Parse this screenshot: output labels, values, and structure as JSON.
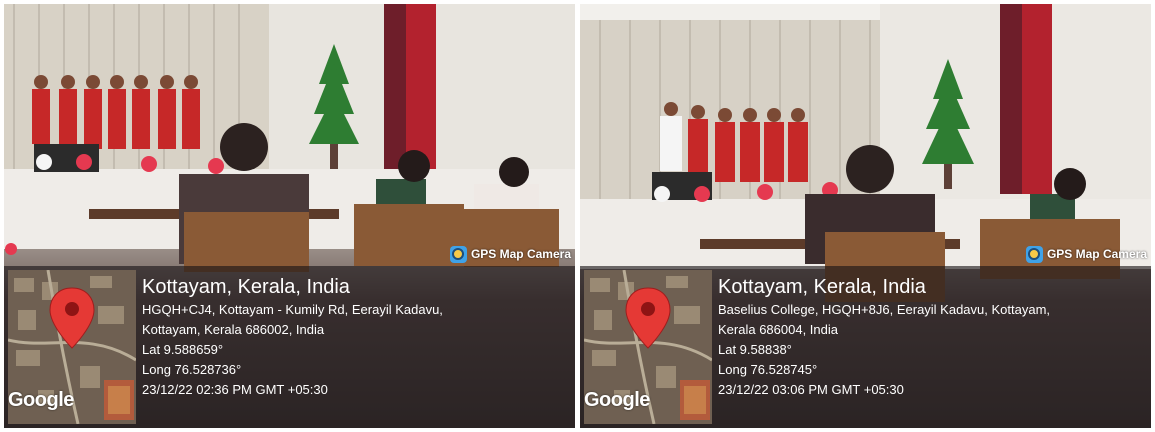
{
  "photos": [
    {
      "watermark": "GPS Map Camera",
      "map_brand": "Google",
      "city": "Kottayam, Kerala, India",
      "address_line1": "HGQH+CJ4, Kottayam - Kumily Rd, Eerayil Kadavu,",
      "address_line2": "Kottayam, Kerala 686002, India",
      "lat": "Lat 9.588659°",
      "long": "Long 76.528736°",
      "datetime": "23/12/22 02:36 PM GMT +05:30"
    },
    {
      "watermark": "GPS Map Camera",
      "map_brand": "Google",
      "city": "Kottayam, Kerala, India",
      "address_line1": "Baselius College, HGQH+8J6, Eerayil Kadavu, Kottayam,",
      "address_line2": "Kerala 686004, India",
      "lat": "Lat 9.58838°",
      "long": "Long 76.528745°",
      "datetime": "23/12/22 03:06 PM GMT +05:30"
    }
  ],
  "icons": {
    "pin": "map-pin-icon",
    "camera": "gps-camera-icon"
  },
  "colors": {
    "pin": "#e53935",
    "overlay": "#191416",
    "camera_badge": "#3fa2e8"
  }
}
